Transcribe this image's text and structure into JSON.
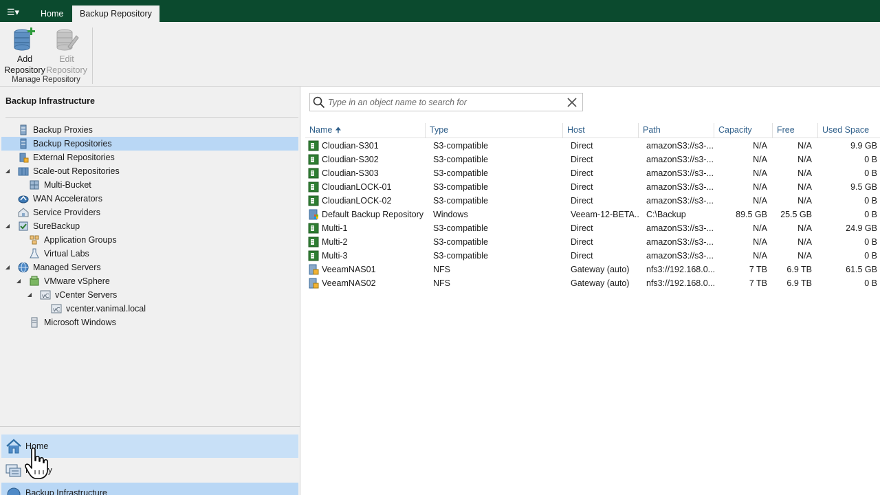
{
  "app": {
    "menu_icon": "hamburger-menu-icon",
    "tabs": [
      {
        "label": "Home"
      },
      {
        "label": "Backup Repository"
      }
    ]
  },
  "ribbon": {
    "add_line1": "Add",
    "add_line2": "Repository",
    "edit_line1": "Edit",
    "edit_line2": "Repository",
    "group_label": "Manage Repository"
  },
  "left_panel": {
    "title": "Backup Infrastructure",
    "tree": [
      {
        "label": "Backup Proxies",
        "icon": "proxy-icon"
      },
      {
        "label": "Backup Repositories",
        "icon": "repository-icon",
        "selected": true
      },
      {
        "label": "External Repositories",
        "icon": "external-repository-icon"
      },
      {
        "label": "Scale-out Repositories",
        "icon": "scale-out-icon",
        "expanded": true
      },
      {
        "label": "Multi-Bucket",
        "icon": "multi-bucket-icon"
      },
      {
        "label": "WAN Accelerators",
        "icon": "wan-accelerator-icon"
      },
      {
        "label": "Service Providers",
        "icon": "service-provider-icon"
      },
      {
        "label": "SureBackup",
        "icon": "surebackup-icon",
        "expanded": true
      },
      {
        "label": "Application Groups",
        "icon": "application-group-icon"
      },
      {
        "label": "Virtual Labs",
        "icon": "virtual-lab-icon"
      },
      {
        "label": "Managed Servers",
        "icon": "managed-servers-icon",
        "expanded": true
      },
      {
        "label": "VMware vSphere",
        "icon": "vsphere-icon",
        "expanded": true
      },
      {
        "label": "vCenter Servers",
        "icon": "vcenter-icon",
        "expanded": true
      },
      {
        "label": "vcenter.vanimal.local",
        "icon": "vcenter-server-icon"
      },
      {
        "label": "Microsoft Windows",
        "icon": "windows-server-icon"
      }
    ],
    "nav": {
      "home": "Home",
      "history": "History",
      "backup_infrastructure": "Backup Infrastructure"
    }
  },
  "search": {
    "placeholder": "Type in an object name to search for"
  },
  "grid": {
    "columns": [
      "Name",
      "Type",
      "Host",
      "Path",
      "Capacity",
      "Free",
      "Used Space"
    ],
    "sort_column": "Name",
    "sort_direction": "ascending",
    "rows": [
      {
        "name": "Cloudian-S301",
        "type": "S3-compatible",
        "host": "Direct",
        "path": "amazonS3://s3-...",
        "capacity": "N/A",
        "free": "N/A",
        "used": "9.9 GB",
        "icon": "s3-repository-icon"
      },
      {
        "name": "Cloudian-S302",
        "type": "S3-compatible",
        "host": "Direct",
        "path": "amazonS3://s3-...",
        "capacity": "N/A",
        "free": "N/A",
        "used": "0 B",
        "icon": "s3-repository-icon"
      },
      {
        "name": "Cloudian-S303",
        "type": "S3-compatible",
        "host": "Direct",
        "path": "amazonS3://s3-...",
        "capacity": "N/A",
        "free": "N/A",
        "used": "0 B",
        "icon": "s3-repository-icon"
      },
      {
        "name": "CloudianLOCK-01",
        "type": "S3-compatible",
        "host": "Direct",
        "path": "amazonS3://s3-...",
        "capacity": "N/A",
        "free": "N/A",
        "used": "9.5 GB",
        "icon": "s3-repository-icon"
      },
      {
        "name": "CloudianLOCK-02",
        "type": "S3-compatible",
        "host": "Direct",
        "path": "amazonS3://s3-...",
        "capacity": "N/A",
        "free": "N/A",
        "used": "0 B",
        "icon": "s3-repository-icon"
      },
      {
        "name": "Default Backup Repository",
        "type": "Windows",
        "host": "Veeam-12-BETA...",
        "path": "C:\\Backup",
        "capacity": "89.5 GB",
        "free": "25.5 GB",
        "used": "0 B",
        "icon": "windows-repository-icon"
      },
      {
        "name": "Multi-1",
        "type": "S3-compatible",
        "host": "Direct",
        "path": "amazonS3://s3-...",
        "capacity": "N/A",
        "free": "N/A",
        "used": "24.9 GB",
        "icon": "s3-repository-icon"
      },
      {
        "name": "Multi-2",
        "type": "S3-compatible",
        "host": "Direct",
        "path": "amazonS3://s3-...",
        "capacity": "N/A",
        "free": "N/A",
        "used": "0 B",
        "icon": "s3-repository-icon"
      },
      {
        "name": "Multi-3",
        "type": "S3-compatible",
        "host": "Direct",
        "path": "amazonS3://s3-...",
        "capacity": "N/A",
        "free": "N/A",
        "used": "0 B",
        "icon": "s3-repository-icon"
      },
      {
        "name": "VeeamNAS01",
        "type": "NFS",
        "host": "Gateway (auto)",
        "path": "nfs3://192.168.0...",
        "capacity": "7 TB",
        "free": "6.9 TB",
        "used": "61.5 GB",
        "icon": "nfs-repository-icon"
      },
      {
        "name": "VeeamNAS02",
        "type": "NFS",
        "host": "Gateway (auto)",
        "path": "nfs3://192.168.0...",
        "capacity": "7 TB",
        "free": "6.9 TB",
        "used": "0 B",
        "icon": "nfs-repository-icon"
      }
    ]
  },
  "colors": {
    "title_bar": "#0b4a2e",
    "selection": "#b9d7f5",
    "header_text": "#2f5f8a",
    "repo_icon_green": "#2e7d32"
  }
}
